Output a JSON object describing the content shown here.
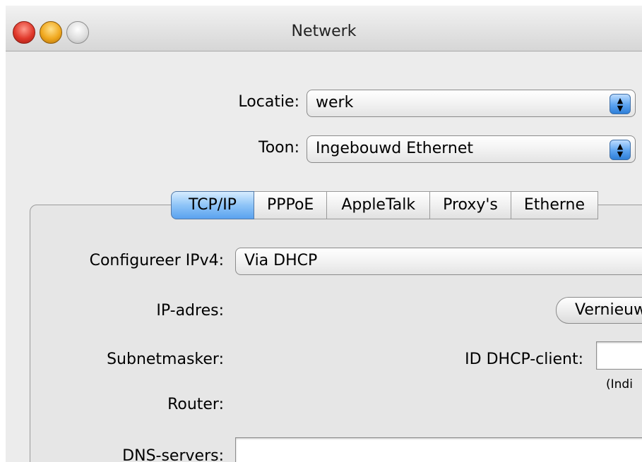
{
  "window": {
    "title": "Netwerk"
  },
  "location": {
    "label": "Locatie:",
    "value": "werk"
  },
  "show": {
    "label": "Toon:",
    "value": "Ingebouwd Ethernet"
  },
  "tabs": [
    {
      "label": "TCP/IP",
      "active": true
    },
    {
      "label": "PPPoE",
      "active": false
    },
    {
      "label": "AppleTalk",
      "active": false
    },
    {
      "label": "Proxy's",
      "active": false
    },
    {
      "label": "Etherne",
      "active": false
    }
  ],
  "tcpip": {
    "configure_label": "Configureer IPv4:",
    "configure_value": "Via DHCP",
    "ip_label": "IP-adres:",
    "renew_button": "Vernieuw",
    "subnet_label": "Subnetmasker:",
    "dhcp_client_label": "ID DHCP-client:",
    "dhcp_hint": "(Indi",
    "router_label": "Router:",
    "dns_label": "DNS-servers:"
  }
}
